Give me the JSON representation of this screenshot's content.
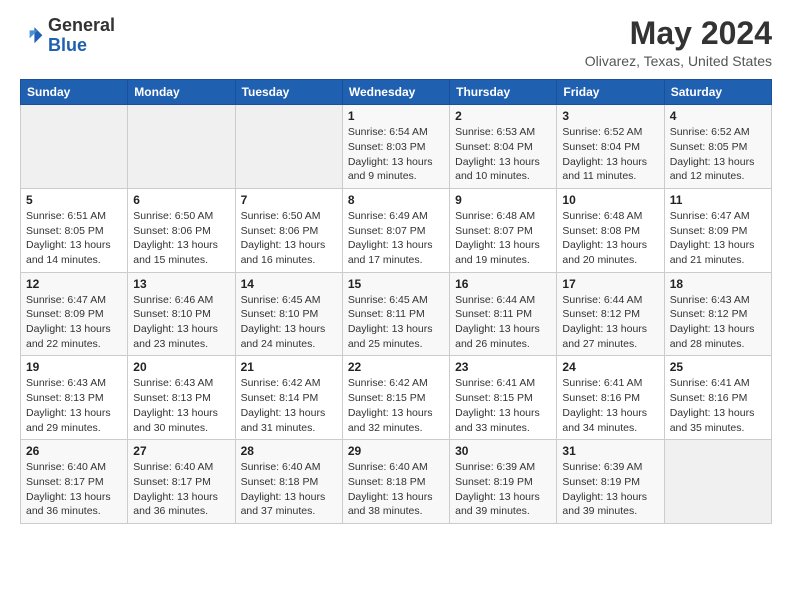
{
  "header": {
    "logo_general": "General",
    "logo_blue": "Blue",
    "month_year": "May 2024",
    "location": "Olivarez, Texas, United States"
  },
  "weekdays": [
    "Sunday",
    "Monday",
    "Tuesday",
    "Wednesday",
    "Thursday",
    "Friday",
    "Saturday"
  ],
  "weeks": [
    [
      {
        "day": "",
        "info": ""
      },
      {
        "day": "",
        "info": ""
      },
      {
        "day": "",
        "info": ""
      },
      {
        "day": "1",
        "info": "Sunrise: 6:54 AM\nSunset: 8:03 PM\nDaylight: 13 hours and 9 minutes."
      },
      {
        "day": "2",
        "info": "Sunrise: 6:53 AM\nSunset: 8:04 PM\nDaylight: 13 hours and 10 minutes."
      },
      {
        "day": "3",
        "info": "Sunrise: 6:52 AM\nSunset: 8:04 PM\nDaylight: 13 hours and 11 minutes."
      },
      {
        "day": "4",
        "info": "Sunrise: 6:52 AM\nSunset: 8:05 PM\nDaylight: 13 hours and 12 minutes."
      }
    ],
    [
      {
        "day": "5",
        "info": "Sunrise: 6:51 AM\nSunset: 8:05 PM\nDaylight: 13 hours and 14 minutes."
      },
      {
        "day": "6",
        "info": "Sunrise: 6:50 AM\nSunset: 8:06 PM\nDaylight: 13 hours and 15 minutes."
      },
      {
        "day": "7",
        "info": "Sunrise: 6:50 AM\nSunset: 8:06 PM\nDaylight: 13 hours and 16 minutes."
      },
      {
        "day": "8",
        "info": "Sunrise: 6:49 AM\nSunset: 8:07 PM\nDaylight: 13 hours and 17 minutes."
      },
      {
        "day": "9",
        "info": "Sunrise: 6:48 AM\nSunset: 8:07 PM\nDaylight: 13 hours and 19 minutes."
      },
      {
        "day": "10",
        "info": "Sunrise: 6:48 AM\nSunset: 8:08 PM\nDaylight: 13 hours and 20 minutes."
      },
      {
        "day": "11",
        "info": "Sunrise: 6:47 AM\nSunset: 8:09 PM\nDaylight: 13 hours and 21 minutes."
      }
    ],
    [
      {
        "day": "12",
        "info": "Sunrise: 6:47 AM\nSunset: 8:09 PM\nDaylight: 13 hours and 22 minutes."
      },
      {
        "day": "13",
        "info": "Sunrise: 6:46 AM\nSunset: 8:10 PM\nDaylight: 13 hours and 23 minutes."
      },
      {
        "day": "14",
        "info": "Sunrise: 6:45 AM\nSunset: 8:10 PM\nDaylight: 13 hours and 24 minutes."
      },
      {
        "day": "15",
        "info": "Sunrise: 6:45 AM\nSunset: 8:11 PM\nDaylight: 13 hours and 25 minutes."
      },
      {
        "day": "16",
        "info": "Sunrise: 6:44 AM\nSunset: 8:11 PM\nDaylight: 13 hours and 26 minutes."
      },
      {
        "day": "17",
        "info": "Sunrise: 6:44 AM\nSunset: 8:12 PM\nDaylight: 13 hours and 27 minutes."
      },
      {
        "day": "18",
        "info": "Sunrise: 6:43 AM\nSunset: 8:12 PM\nDaylight: 13 hours and 28 minutes."
      }
    ],
    [
      {
        "day": "19",
        "info": "Sunrise: 6:43 AM\nSunset: 8:13 PM\nDaylight: 13 hours and 29 minutes."
      },
      {
        "day": "20",
        "info": "Sunrise: 6:43 AM\nSunset: 8:13 PM\nDaylight: 13 hours and 30 minutes."
      },
      {
        "day": "21",
        "info": "Sunrise: 6:42 AM\nSunset: 8:14 PM\nDaylight: 13 hours and 31 minutes."
      },
      {
        "day": "22",
        "info": "Sunrise: 6:42 AM\nSunset: 8:15 PM\nDaylight: 13 hours and 32 minutes."
      },
      {
        "day": "23",
        "info": "Sunrise: 6:41 AM\nSunset: 8:15 PM\nDaylight: 13 hours and 33 minutes."
      },
      {
        "day": "24",
        "info": "Sunrise: 6:41 AM\nSunset: 8:16 PM\nDaylight: 13 hours and 34 minutes."
      },
      {
        "day": "25",
        "info": "Sunrise: 6:41 AM\nSunset: 8:16 PM\nDaylight: 13 hours and 35 minutes."
      }
    ],
    [
      {
        "day": "26",
        "info": "Sunrise: 6:40 AM\nSunset: 8:17 PM\nDaylight: 13 hours and 36 minutes."
      },
      {
        "day": "27",
        "info": "Sunrise: 6:40 AM\nSunset: 8:17 PM\nDaylight: 13 hours and 36 minutes."
      },
      {
        "day": "28",
        "info": "Sunrise: 6:40 AM\nSunset: 8:18 PM\nDaylight: 13 hours and 37 minutes."
      },
      {
        "day": "29",
        "info": "Sunrise: 6:40 AM\nSunset: 8:18 PM\nDaylight: 13 hours and 38 minutes."
      },
      {
        "day": "30",
        "info": "Sunrise: 6:39 AM\nSunset: 8:19 PM\nDaylight: 13 hours and 39 minutes."
      },
      {
        "day": "31",
        "info": "Sunrise: 6:39 AM\nSunset: 8:19 PM\nDaylight: 13 hours and 39 minutes."
      },
      {
        "day": "",
        "info": ""
      }
    ]
  ]
}
